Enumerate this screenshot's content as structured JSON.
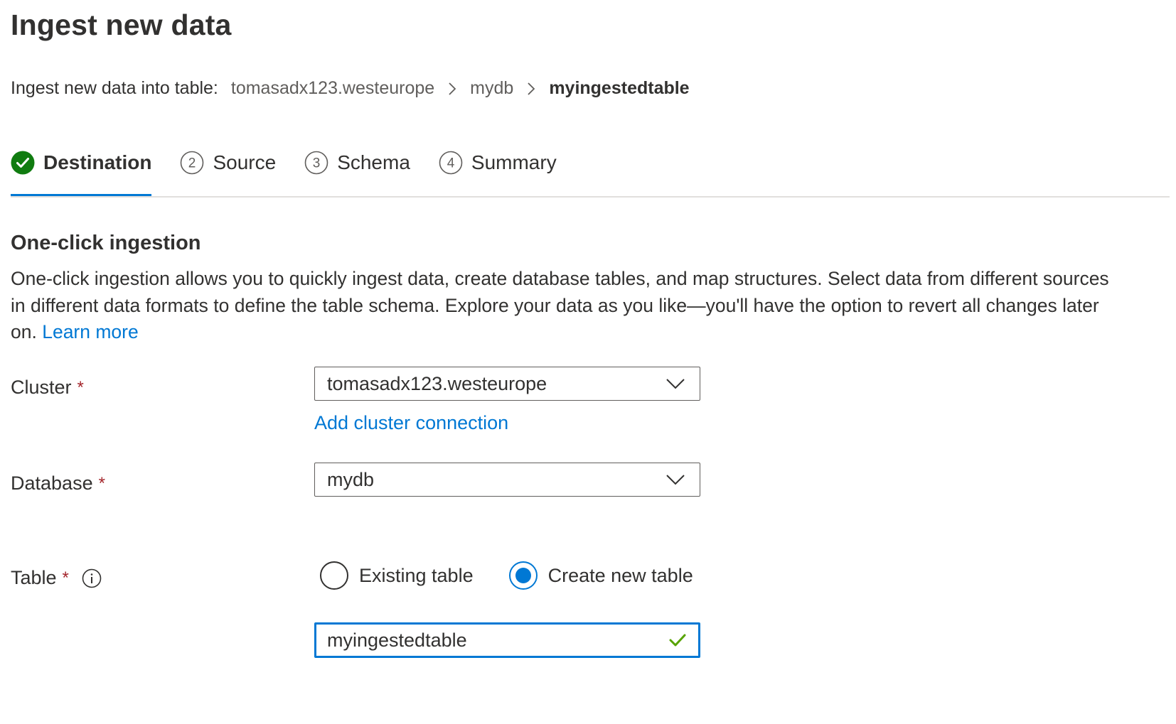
{
  "page": {
    "title": "Ingest new data"
  },
  "breadcrumb": {
    "prefix": "Ingest new data into table:",
    "items": [
      "tomasadx123.westeurope",
      "mydb",
      "myingestedtable"
    ]
  },
  "steps": [
    {
      "number": "1",
      "label": "Destination",
      "state": "completed",
      "active": true
    },
    {
      "number": "2",
      "label": "Source",
      "state": "pending",
      "active": false
    },
    {
      "number": "3",
      "label": "Schema",
      "state": "pending",
      "active": false
    },
    {
      "number": "4",
      "label": "Summary",
      "state": "pending",
      "active": false
    }
  ],
  "section": {
    "title": "One-click ingestion",
    "description": "One-click ingestion allows you to quickly ingest data, create database tables, and map structures. Select data from different sources in different data formats to define the table schema. Explore your data as you like—you'll have the option to revert all changes later on.",
    "learn_more": "Learn more"
  },
  "form": {
    "cluster": {
      "label": "Cluster",
      "required_mark": "*",
      "value": "tomasadx123.westeurope",
      "add_link": "Add cluster connection"
    },
    "database": {
      "label": "Database",
      "required_mark": "*",
      "value": "mydb"
    },
    "table": {
      "label": "Table",
      "required_mark": "*",
      "options": [
        "Existing table",
        "Create new table"
      ],
      "selected": "Create new table",
      "input_value": "myingestedtable"
    }
  },
  "icons": {
    "completed_step": "check-circle-icon",
    "breadcrumb_separator": "chevron-right-icon",
    "dropdown": "chevron-down-icon",
    "info": "info-icon",
    "valid": "checkmark-icon"
  },
  "colors": {
    "accent": "#0078d4",
    "success": "#107c10",
    "valid_check": "#57a300",
    "required": "#a4262c",
    "text": "#323130"
  }
}
